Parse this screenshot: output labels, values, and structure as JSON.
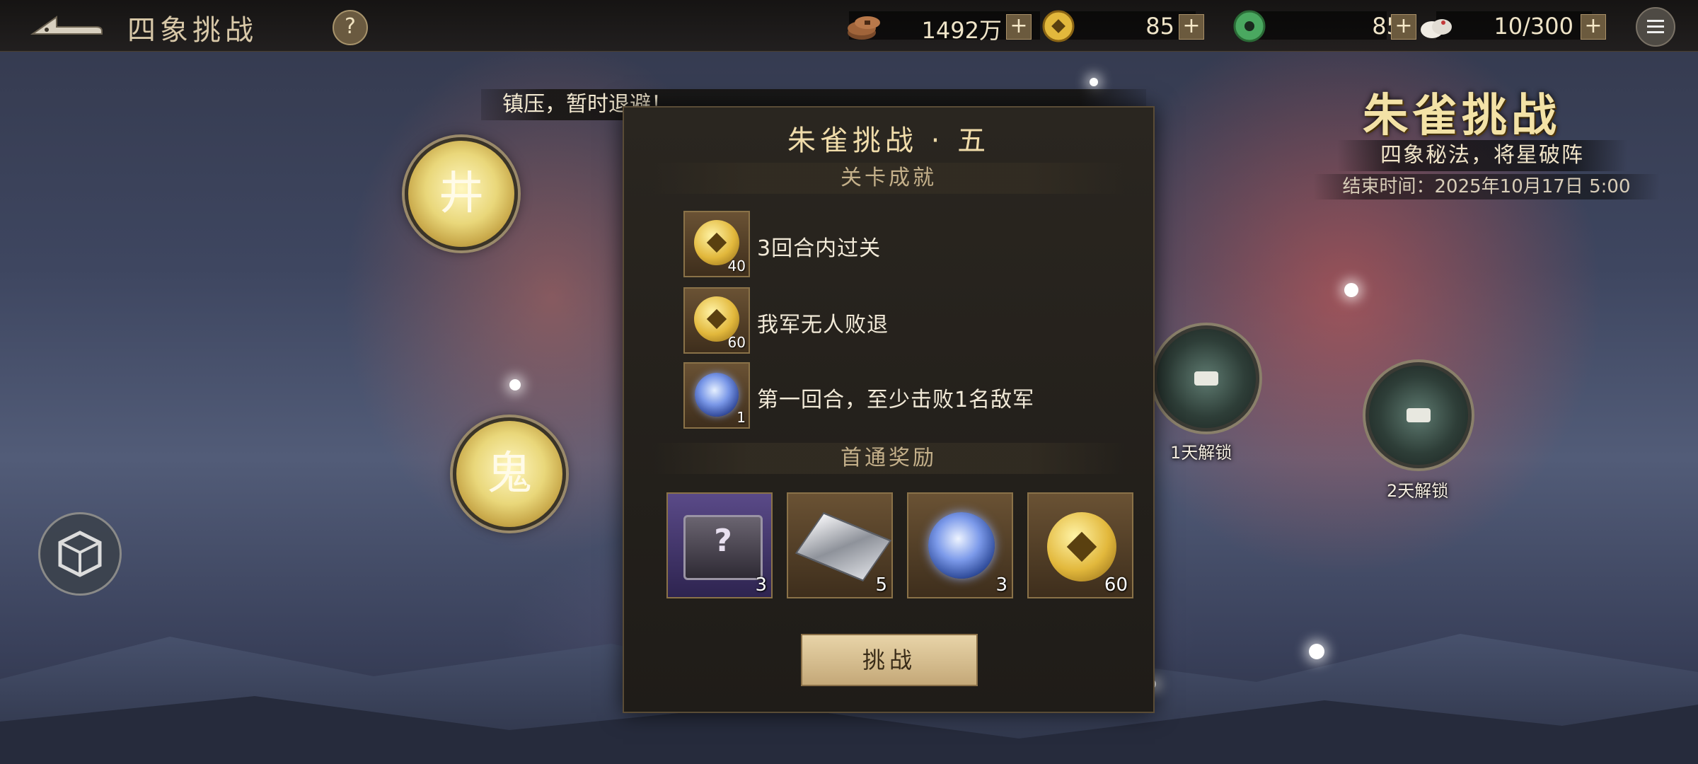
{
  "header": {
    "title": "四象挑战",
    "help_label": "?",
    "resources": [
      {
        "icon": "copper-coins-icon",
        "value": "1492万",
        "plus": "+"
      },
      {
        "icon": "gold-coin-icon",
        "value": "85",
        "plus": "+"
      },
      {
        "icon": "jade-disc-icon",
        "value": "85",
        "plus": "+"
      },
      {
        "icon": "steamed-bun-icon",
        "value": "10/300",
        "plus": "+"
      }
    ]
  },
  "event": {
    "title": "朱雀挑战",
    "subtitle": "四象秘法，将星破阵",
    "end_time": "结束时间：2025年10月17日 5:00"
  },
  "quote": "镇压，暂时退避！",
  "nodes": {
    "node1": "井",
    "node2": "鬼",
    "locked": [
      {
        "label": "1天解锁"
      },
      {
        "label": "2天解锁"
      }
    ]
  },
  "panel": {
    "title": "朱雀挑战 · 五",
    "achievements_header": "关卡成就",
    "achievements": [
      {
        "text": "3回合内过关",
        "count": "40",
        "icon": "gold-coin-icon"
      },
      {
        "text": "我军无人败退",
        "count": "60",
        "icon": "gold-coin-icon"
      },
      {
        "text": "第一回合，至少击败1名敌军",
        "count": "1",
        "icon": "blue-orb-icon"
      }
    ],
    "rewards_header": "首通奖励",
    "rewards": [
      {
        "icon": "mystery-chest-icon",
        "count": "3"
      },
      {
        "icon": "silver-ingot-icon",
        "count": "5"
      },
      {
        "icon": "blue-orb-icon",
        "count": "3"
      },
      {
        "icon": "gold-coin-icon",
        "count": "60"
      }
    ],
    "challenge_label": "挑战"
  },
  "colors": {
    "accent_gold": "#f3e2a6",
    "panel_bg": "#1f1c18",
    "button_bg": "#d8c090"
  }
}
